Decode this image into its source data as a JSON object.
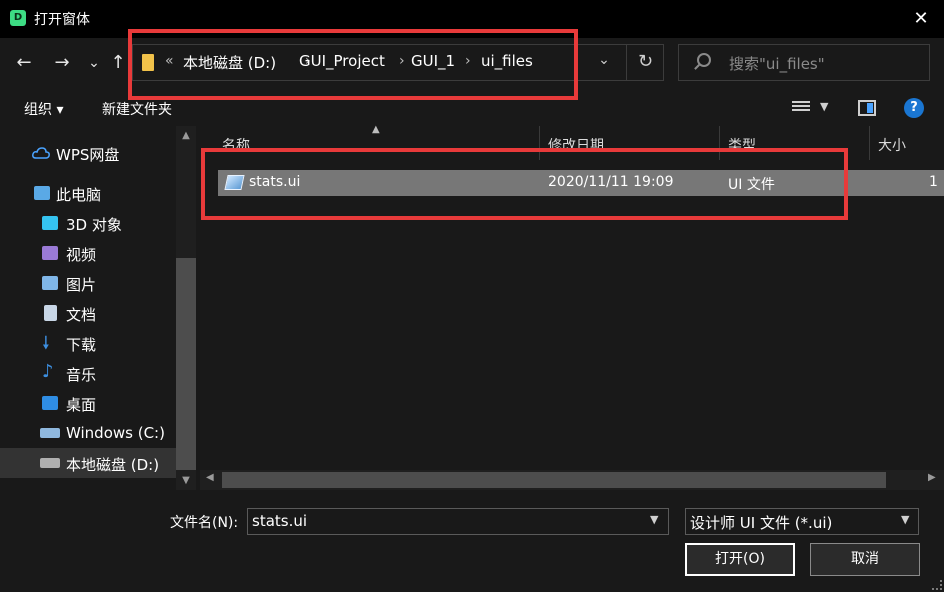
{
  "window": {
    "title": "打开窗体",
    "app_icon_letter": "D",
    "close_glyph": "✕"
  },
  "nav": {
    "back_glyph": "←",
    "forward_glyph": "→",
    "recent_glyph": "⌄",
    "up_glyph": "↑",
    "address_prefix": "«",
    "breadcrumbs": [
      "本地磁盘 (D:)",
      "GUI_Project",
      "GUI_1",
      "ui_files"
    ],
    "separator": "›",
    "dropdown_glyph": "⌄",
    "refresh_glyph": "↻",
    "search_placeholder": "搜索\"ui_files\""
  },
  "toolbar": {
    "organize_label": "组织 ▾",
    "new_folder_label": "新建文件夹",
    "help_glyph": "?"
  },
  "sidebar": {
    "items": [
      {
        "label": "WPS网盘",
        "icon": "cloud-icon",
        "color": "#4aa3ff"
      },
      {
        "label": "此电脑",
        "icon": "computer-icon",
        "color": "#5aa9e6"
      },
      {
        "label": "3D 对象",
        "icon": "cube-icon",
        "color": "#35c3f0"
      },
      {
        "label": "视频",
        "icon": "video-icon",
        "color": "#9a7ad6"
      },
      {
        "label": "图片",
        "icon": "picture-icon",
        "color": "#7fb6e8"
      },
      {
        "label": "文档",
        "icon": "document-icon",
        "color": "#c8d6e6"
      },
      {
        "label": "下载",
        "icon": "download-icon",
        "color": "#3d8fe0"
      },
      {
        "label": "音乐",
        "icon": "music-icon",
        "color": "#3d8fe0"
      },
      {
        "label": "桌面",
        "icon": "desktop-icon",
        "color": "#2f8de4"
      },
      {
        "label": "Windows (C:)",
        "icon": "drive-icon",
        "color": "#8fb8de"
      },
      {
        "label": "本地磁盘 (D:)",
        "icon": "drive-icon",
        "color": "#b0b0b0"
      }
    ],
    "selected_index": 10
  },
  "columns": [
    "名称",
    "修改日期",
    "类型",
    "大小"
  ],
  "files": [
    {
      "name": "stats.ui",
      "modified": "2020/11/11 19:09",
      "type": "UI 文件",
      "size": "1"
    }
  ],
  "bottom": {
    "filename_label": "文件名(N):",
    "filename_value": "stats.ui",
    "filetype_value": "设计师 UI 文件 (*.ui)",
    "open_label": "打开(O)",
    "cancel_label": "取消"
  },
  "colors": {
    "highlight": "#e83a3a",
    "selected_row": "#777777",
    "background": "#191919"
  }
}
